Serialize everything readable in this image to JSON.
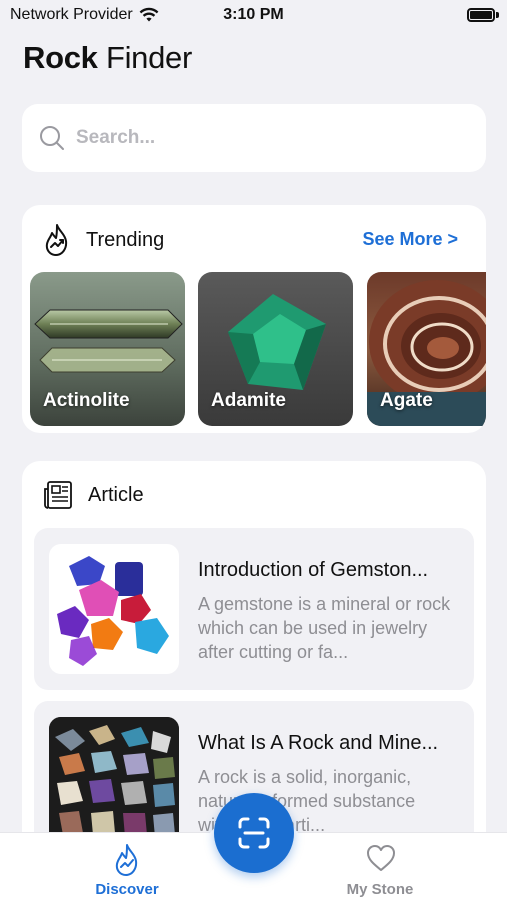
{
  "status_bar": {
    "carrier": "Network Provider",
    "time": "3:10 PM"
  },
  "header": {
    "title_bold": "Rock",
    "title_light": "Finder"
  },
  "search": {
    "placeholder": "Search..."
  },
  "trending": {
    "title": "Trending",
    "see_more": "See More >",
    "stones": [
      {
        "name": "Actinolite"
      },
      {
        "name": "Adamite"
      },
      {
        "name": "Agate"
      }
    ]
  },
  "article": {
    "title": "Article",
    "items": [
      {
        "title": "Introduction of Gemston...",
        "body": "A gemstone is a mineral or rock which can be used in jewelry after cutting or fa..."
      },
      {
        "title": "What Is A Rock and Mine...",
        "body": "A rock is a solid, inorganic, naturally-formed substance without a parti..."
      }
    ]
  },
  "bottom_nav": {
    "discover": "Discover",
    "my_stone": "My Stone"
  },
  "colors": {
    "accent": "#1e6fd6",
    "background": "#f1f1f5"
  }
}
